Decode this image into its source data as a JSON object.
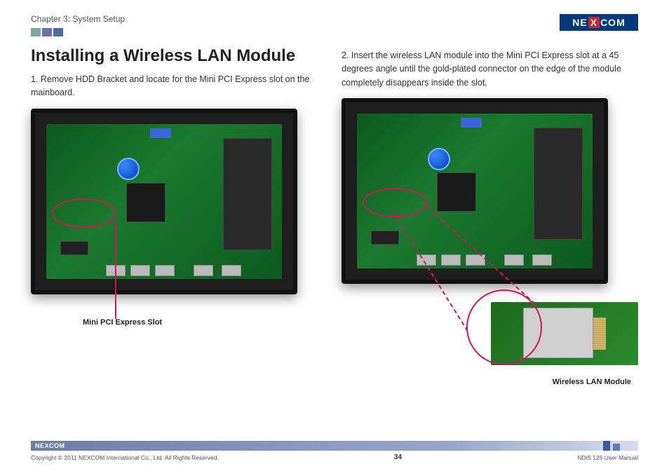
{
  "header": {
    "chapter": "Chapter 3: System Setup",
    "logo_parts": {
      "pre": "NE",
      "mid": "X",
      "post": "COM"
    }
  },
  "title": "Installing a Wireless LAN Module",
  "steps": {
    "s1_num": "1. ",
    "s1": "Remove HDD Bracket and locate for the Mini PCI Express slot on the mainboard.",
    "s2_num": "2. ",
    "s2": "Insert the wireless LAN module into the Mini PCI Express slot at a 45 degrees angle until the gold-plated connector on the edge of the module completely disappears inside the slot."
  },
  "captions": {
    "left": "Mini PCI Express Slot",
    "right": "Wireless LAN Module"
  },
  "footer": {
    "logo": "NEXCOM",
    "copyright": "Copyright © 2011 NEXCOM International Co., Ltd. All Rights Reserved.",
    "page": "34",
    "doc": "NDiS 126 User Manual"
  },
  "colors": {
    "brand_blue": "#003a7a",
    "brand_red": "#d2232a",
    "accent_pink": "#d4145a",
    "bar_teal": "#7aa9a3",
    "bar_purple": "#6d6fa8",
    "bar_blue": "#4a6aa8"
  }
}
